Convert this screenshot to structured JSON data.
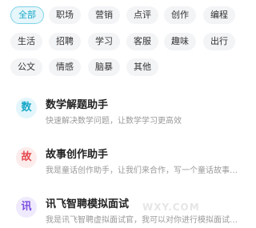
{
  "categories": [
    {
      "label": "全部",
      "active": true
    },
    {
      "label": "职场",
      "active": false
    },
    {
      "label": "营销",
      "active": false
    },
    {
      "label": "点评",
      "active": false
    },
    {
      "label": "创作",
      "active": false
    },
    {
      "label": "编程",
      "active": false
    },
    {
      "label": "生活",
      "active": false
    },
    {
      "label": "招聘",
      "active": false
    },
    {
      "label": "学习",
      "active": false
    },
    {
      "label": "客服",
      "active": false
    },
    {
      "label": "趣味",
      "active": false
    },
    {
      "label": "出行",
      "active": false
    },
    {
      "label": "公文",
      "active": false
    },
    {
      "label": "情感",
      "active": false
    },
    {
      "label": "脑暴",
      "active": false
    },
    {
      "label": "其他",
      "active": false
    }
  ],
  "assistants": [
    {
      "icon": "数",
      "title": "数学解题助手",
      "desc": "快速解决数学问题，让数学学习更高效",
      "icon_bg": "#e3f6fb",
      "icon_color": "#1aa8c9"
    },
    {
      "icon": "故",
      "title": "故事创作助手",
      "desc": "我是童话创作助手，让我们来合作，写一个童话故事…",
      "icon_bg": "#fdecec",
      "icon_color": "#e5484d"
    },
    {
      "icon": "讯",
      "title": "讯飞智聘模拟面试",
      "desc": "我是讯飞智聘虚拟面试官，我可以对你进行模拟面试…",
      "icon_bg": "#efeafd",
      "icon_color": "#7b4de0"
    }
  ],
  "watermark": "WXY.COM"
}
